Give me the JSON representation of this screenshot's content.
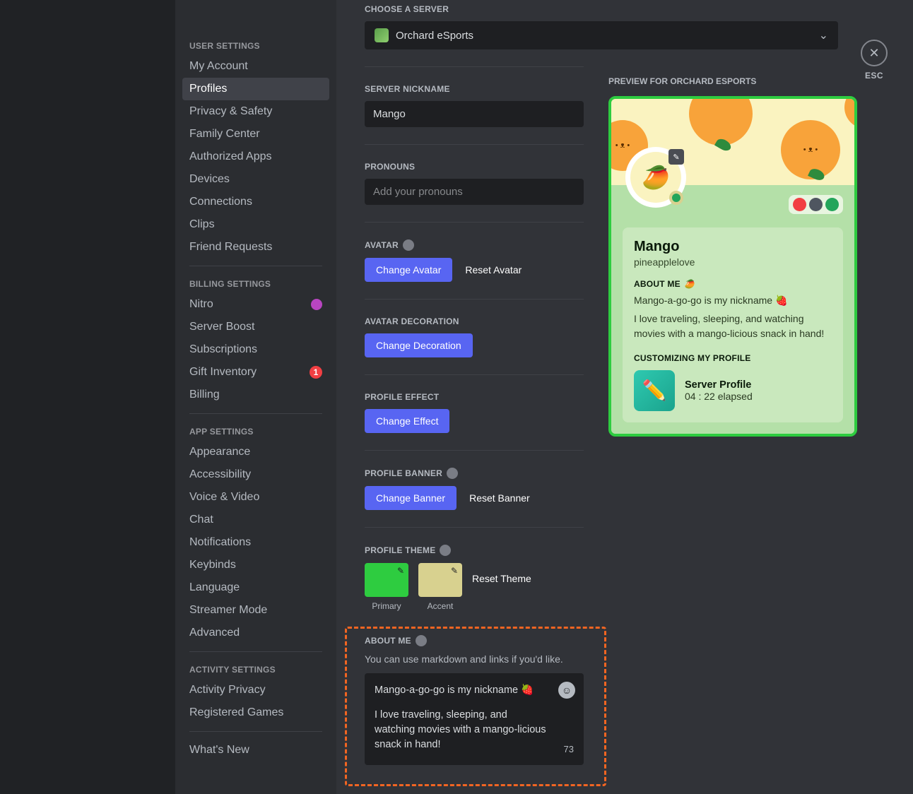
{
  "sidebar": {
    "groups": [
      {
        "header": "User Settings",
        "items": [
          {
            "label": "My Account"
          },
          {
            "label": "Profiles",
            "active": true
          },
          {
            "label": "Privacy & Safety"
          },
          {
            "label": "Family Center"
          },
          {
            "label": "Authorized Apps"
          },
          {
            "label": "Devices"
          },
          {
            "label": "Connections"
          },
          {
            "label": "Clips"
          },
          {
            "label": "Friend Requests"
          }
        ]
      },
      {
        "header": "Billing Settings",
        "items": [
          {
            "label": "Nitro",
            "trailing": "nitro"
          },
          {
            "label": "Server Boost"
          },
          {
            "label": "Subscriptions"
          },
          {
            "label": "Gift Inventory",
            "badge": "1"
          },
          {
            "label": "Billing"
          }
        ]
      },
      {
        "header": "App Settings",
        "items": [
          {
            "label": "Appearance"
          },
          {
            "label": "Accessibility"
          },
          {
            "label": "Voice & Video"
          },
          {
            "label": "Chat"
          },
          {
            "label": "Notifications"
          },
          {
            "label": "Keybinds"
          },
          {
            "label": "Language"
          },
          {
            "label": "Streamer Mode"
          },
          {
            "label": "Advanced"
          }
        ]
      },
      {
        "header": "Activity Settings",
        "items": [
          {
            "label": "Activity Privacy"
          },
          {
            "label": "Registered Games"
          }
        ]
      }
    ],
    "footer_item": "What's New"
  },
  "form": {
    "choose_server_label": "Choose a Server",
    "server_name": "Orchard eSports",
    "nickname_label": "Server Nickname",
    "nickname_value": "Mango",
    "pronouns_label": "Pronouns",
    "pronouns_placeholder": "Add your pronouns",
    "avatar_label": "Avatar",
    "change_avatar": "Change Avatar",
    "reset_avatar": "Reset Avatar",
    "avatar_deco_label": "Avatar Decoration",
    "change_decoration": "Change Decoration",
    "effect_label": "Profile Effect",
    "change_effect": "Change Effect",
    "banner_label": "Profile Banner",
    "change_banner": "Change Banner",
    "reset_banner": "Reset Banner",
    "theme_label": "Profile Theme",
    "theme_primary": "Primary",
    "theme_accent": "Accent",
    "reset_theme": "Reset Theme",
    "about_label": "About Me",
    "about_hint": "You can use markdown and links if you'd like.",
    "about_text_line1": "Mango-a-go-go is my nickname 🍓",
    "about_text_line2": "I love traveling, sleeping, and watching movies with a mango-licious snack in hand!",
    "about_count": "73",
    "colors": {
      "primary": "#2ecc40",
      "accent": "#d8d18f"
    }
  },
  "preview": {
    "title": "Preview for Orchard eSports",
    "display_name": "Mango",
    "handle": "pineapplelove",
    "about_heading": "About Me",
    "about_line1": "Mango-a-go-go is my nickname 🍓",
    "about_line2": "I love traveling, sleeping, and watching movies with a mango-licious snack in hand!",
    "activity_heading": "Customizing My Profile",
    "activity_title": "Server Profile",
    "activity_sub": "04 : 22 elapsed"
  },
  "close": {
    "label": "ESC"
  }
}
